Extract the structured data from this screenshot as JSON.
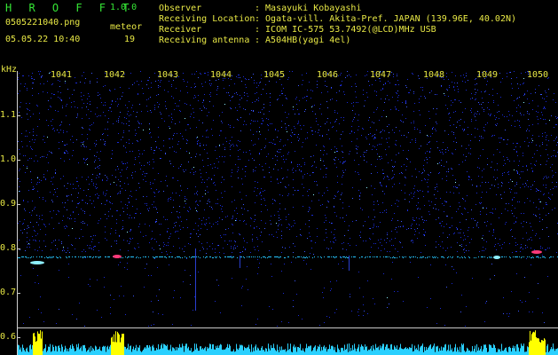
{
  "header": {
    "brand": "H R O F F T",
    "version": "1.0.0",
    "filename": "0505221040.png",
    "meteor_label": "meteor",
    "datetime": "05.05.22 10:40",
    "meteor_count": "19"
  },
  "info": [
    {
      "label": "Observer",
      "value": ": Masayuki Kobayashi"
    },
    {
      "label": "Receiving Location",
      "value": ": Ogata-vill. Akita-Pref. JAPAN (139.96E, 40.02N)"
    },
    {
      "label": "Receiver",
      "value": ": ICOM IC-575 53.7492(@LCD)MHz USB"
    },
    {
      "label": "Receiving antenna",
      "value": ": A504HB(yagi 4el)"
    }
  ],
  "spectrogram": {
    "unit": "kHz",
    "minutes": [
      "1041",
      "1042",
      "1043",
      "1044",
      "1045",
      "1046",
      "1047",
      "1048",
      "1049",
      "1050"
    ],
    "freq_ticks": [
      "1.1",
      "1.0",
      "0.9",
      "0.8",
      "0.7",
      "0.6"
    ],
    "echo_frequency_khz": 0.785,
    "colors": {
      "background": "#000000",
      "noise": "#1a2bd8",
      "signal": "#8ef0ff",
      "strong": "#ff3a7a",
      "trace": "#26c7ff",
      "peaks": "#ffff00",
      "text": "#e8e845",
      "brand": "#35e635"
    }
  }
}
